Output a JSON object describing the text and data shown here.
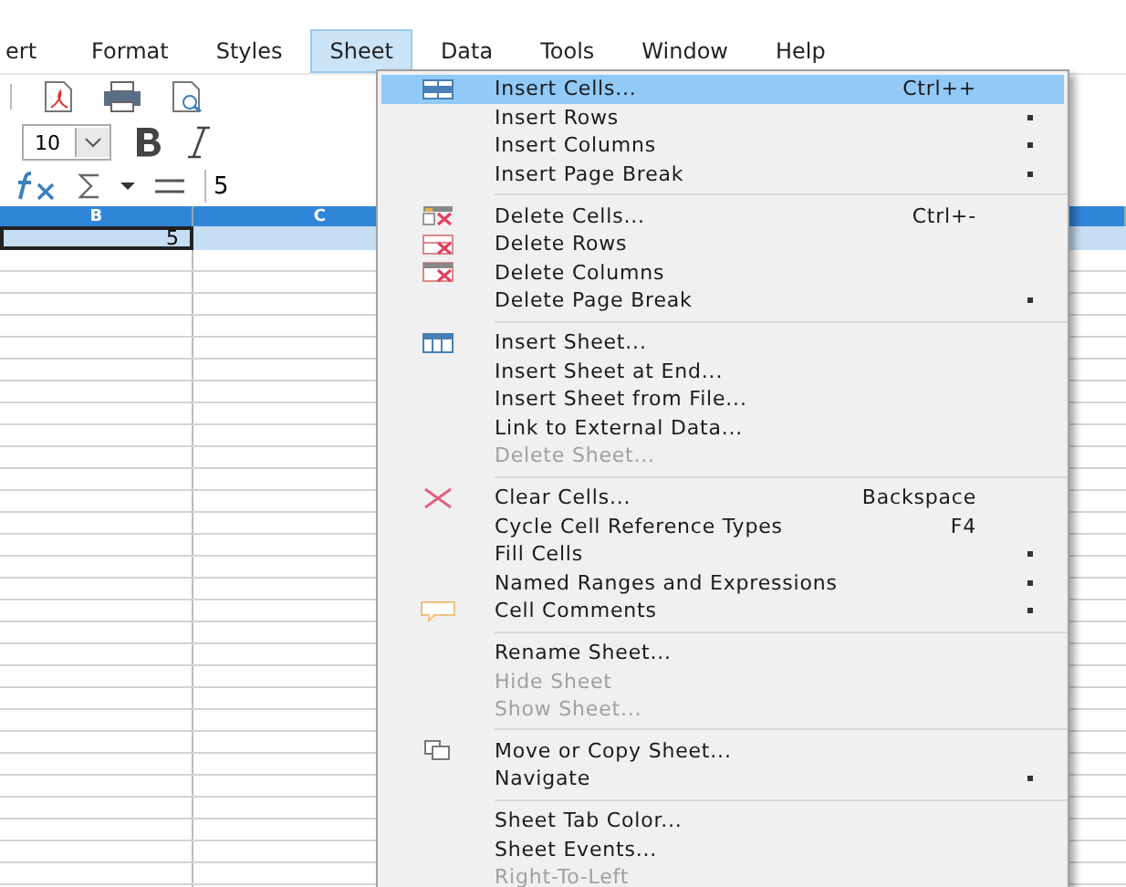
{
  "menubar": [
    {
      "label": "ert",
      "selected": false
    },
    {
      "label": "Format",
      "selected": false
    },
    {
      "label": "Styles",
      "selected": false
    },
    {
      "label": "Sheet",
      "selected": true
    },
    {
      "label": "Data",
      "selected": false
    },
    {
      "label": "Tools",
      "selected": false
    },
    {
      "label": "Window",
      "selected": false
    },
    {
      "label": "Help",
      "selected": false
    }
  ],
  "formatting": {
    "font_size": "10"
  },
  "formula_bar": {
    "value": "5"
  },
  "sheet": {
    "columns": [
      {
        "label": "B",
        "selected": true
      },
      {
        "label": "C",
        "selected": true
      }
    ],
    "cell_b1": "5"
  },
  "menu": {
    "groups": [
      {
        "items": [
          {
            "label": "Insert Cells...",
            "shortcut": "Ctrl++",
            "submenu": false,
            "disabled": false,
            "selected": true
          },
          {
            "label": "Insert Rows",
            "submenu": true,
            "disabled": false,
            "selected": false
          },
          {
            "label": "Insert Columns",
            "submenu": true,
            "disabled": false,
            "selected": false
          },
          {
            "label": "Insert Page Break",
            "submenu": true,
            "disabled": false,
            "selected": false
          }
        ]
      },
      {
        "items": [
          {
            "label": "Delete Cells...",
            "shortcut": "Ctrl+-",
            "submenu": false,
            "disabled": false,
            "selected": false
          },
          {
            "label": "Delete Rows",
            "submenu": false,
            "disabled": false,
            "selected": false
          },
          {
            "label": "Delete Columns",
            "submenu": false,
            "disabled": false,
            "selected": false
          },
          {
            "label": "Delete Page Break",
            "submenu": true,
            "disabled": false,
            "selected": false
          }
        ]
      },
      {
        "items": [
          {
            "label": "Insert Sheet...",
            "submenu": false,
            "disabled": false,
            "selected": false
          },
          {
            "label": "Insert Sheet at End...",
            "submenu": false,
            "disabled": false,
            "selected": false
          },
          {
            "label": "Insert Sheet from File...",
            "submenu": false,
            "disabled": false,
            "selected": false
          },
          {
            "label": "Link to External Data...",
            "submenu": false,
            "disabled": false,
            "selected": false
          },
          {
            "label": "Delete Sheet...",
            "submenu": false,
            "disabled": true,
            "selected": false
          }
        ]
      },
      {
        "items": [
          {
            "label": "Clear Cells...",
            "shortcut": "Backspace",
            "submenu": false,
            "disabled": false,
            "selected": false
          },
          {
            "label": "Cycle Cell Reference Types",
            "shortcut": "F4",
            "submenu": false,
            "disabled": false,
            "selected": false
          },
          {
            "label": "Fill Cells",
            "submenu": true,
            "disabled": false,
            "selected": false
          },
          {
            "label": "Named Ranges and Expressions",
            "submenu": true,
            "disabled": false,
            "selected": false
          },
          {
            "label": "Cell Comments",
            "submenu": true,
            "disabled": false,
            "selected": false
          }
        ]
      },
      {
        "items": [
          {
            "label": "Rename Sheet...",
            "submenu": false,
            "disabled": false,
            "selected": false
          },
          {
            "label": "Hide Sheet",
            "submenu": false,
            "disabled": true,
            "selected": false
          },
          {
            "label": "Show Sheet...",
            "submenu": false,
            "disabled": true,
            "selected": false
          }
        ]
      },
      {
        "items": [
          {
            "label": "Move or Copy Sheet...",
            "submenu": false,
            "disabled": false,
            "selected": false
          },
          {
            "label": "Navigate",
            "submenu": true,
            "disabled": false,
            "selected": false
          }
        ]
      },
      {
        "items": [
          {
            "label": "Sheet Tab Color...",
            "submenu": false,
            "disabled": false,
            "selected": false
          },
          {
            "label": "Sheet Events...",
            "submenu": false,
            "disabled": false,
            "selected": false
          },
          {
            "label": "Right-To-Left",
            "submenu": false,
            "disabled": true,
            "selected": false
          }
        ]
      }
    ]
  }
}
